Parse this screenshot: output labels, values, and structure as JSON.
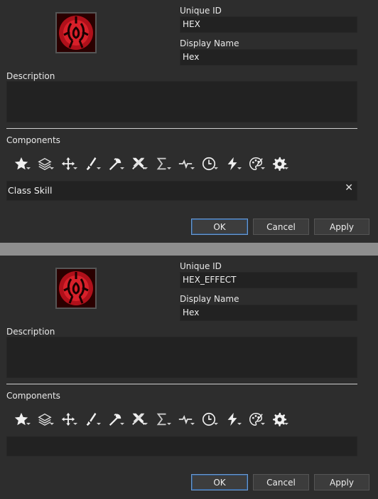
{
  "panels": [
    {
      "icon": "hex-skill-icon",
      "unique_id_label": "Unique ID",
      "unique_id_value": "HEX",
      "display_name_label": "Display Name",
      "display_name_value": "Hex",
      "description_label": "Description",
      "components_label": "Components",
      "components": [
        "Class Skill"
      ],
      "buttons": {
        "ok": "OK",
        "cancel": "Cancel",
        "apply": "Apply"
      }
    },
    {
      "icon": "hex-skill-icon",
      "unique_id_label": "Unique ID",
      "unique_id_value": "HEX_EFFECT",
      "display_name_label": "Display Name",
      "display_name_value": "Hex",
      "description_label": "Description",
      "components_label": "Components",
      "components": [],
      "buttons": {
        "ok": "OK",
        "cancel": "Cancel",
        "apply": "Apply"
      }
    }
  ],
  "toolbar_icons": [
    "star-icon",
    "layers-icon",
    "move-arrows-icon",
    "sword-icon",
    "axe-icon",
    "crossed-swords-icon",
    "sigma-icon",
    "pulse-icon",
    "clock-icon",
    "lightning-icon",
    "palette-icon",
    "gear-icon"
  ],
  "colors": {
    "accent_border": "#6d9ad0",
    "panel_bg": "#2d2d2d",
    "field_bg": "#222222",
    "separator": "#8e8e8e",
    "icon_red": "#c0141c"
  }
}
